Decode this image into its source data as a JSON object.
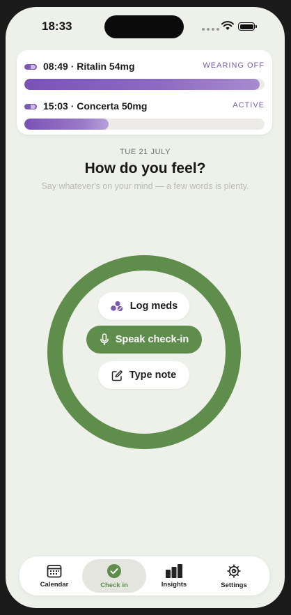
{
  "status_bar": {
    "time": "18:33"
  },
  "medications": [
    {
      "title": "08:49 · Ritalin 54mg",
      "status": "WEARING OFF",
      "progress": 0.98
    },
    {
      "title": "15:03 · Concerta 50mg",
      "status": "ACTIVE",
      "progress": 0.35
    }
  ],
  "header": {
    "date": "TUE 21 JULY",
    "title": "How do you feel?",
    "subtitle": "Say whatever's on your mind — a few words is plenty."
  },
  "actions": {
    "log_meds": "Log meds",
    "speak_checkin": "Speak check-in",
    "type_note": "Type note"
  },
  "tabs": [
    {
      "label": "Calendar",
      "icon": "calendar-icon",
      "selected": false
    },
    {
      "label": "Check in",
      "icon": "check-circle-icon",
      "selected": true
    },
    {
      "label": "Insights",
      "icon": "bar-chart-icon",
      "selected": false
    },
    {
      "label": "Settings",
      "icon": "gear-icon",
      "selected": false
    }
  ],
  "colors": {
    "accent_green": "#5f8d4b",
    "accent_purple": "#7a5bb0",
    "background": "#eef0ea"
  }
}
